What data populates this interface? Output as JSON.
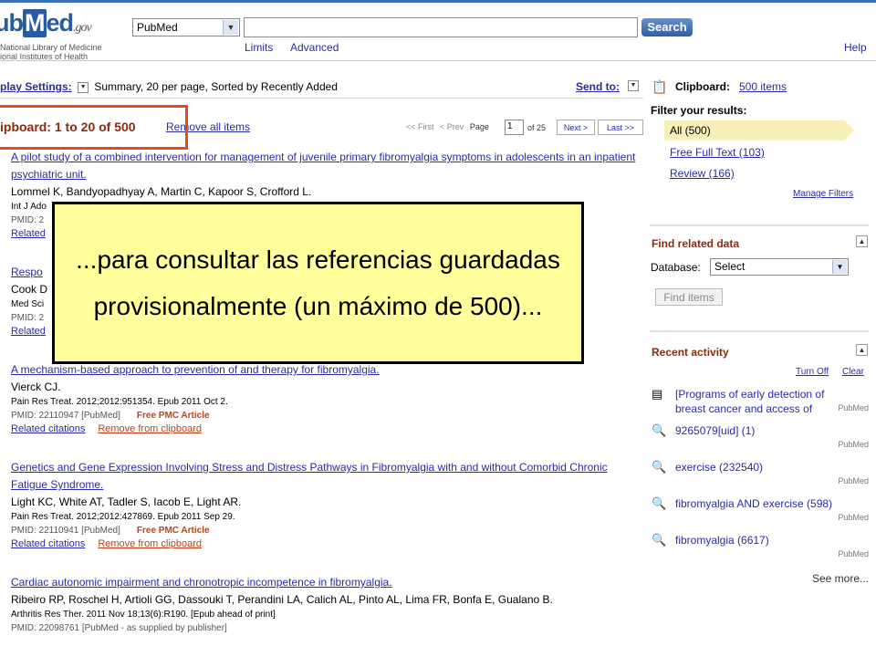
{
  "header": {
    "logo_text": "PubMed",
    "logo_gov": ".gov",
    "nlm_line1": "National Library of Medicine",
    "nlm_line2": "ional Institutes of Health",
    "db_value": "PubMed",
    "search_label": "Search",
    "limits": "Limits",
    "advanced": "Advanced",
    "help": "Help"
  },
  "toolbar": {
    "display_settings_label": "play Settings:",
    "display_settings_value": "Summary, 20 per page, Sorted by Recently Added",
    "send_to": "Send to:"
  },
  "clipboard": {
    "count": "ipboard: 1 to 20 of 500",
    "remove_all": "Remove all items"
  },
  "pager": {
    "first": "<< First",
    "prev": "< Prev",
    "page_label": "Page",
    "page_value": "1",
    "of": "of 25",
    "next": "Next >",
    "last": "Last >>"
  },
  "results": [
    {
      "title": "A pilot study of a combined intervention for management of juvenile primary fibromyalgia symptoms in adolescents in an inpatient psychiatric unit.",
      "authors": "Lommel K, Bandyopadhyay A, Martin C, Kapoor S, Crofford L.",
      "journal": "Int J Ado",
      "pmid": "PMID: 2",
      "related": "Related"
    },
    {
      "title": "Respo",
      "authors": "Cook D",
      "journal": "Med Sci",
      "pmid": "PMID: 2",
      "related": "Related"
    },
    {
      "title": "A mechanism-based approach to prevention of and therapy for fibromyalgia.",
      "authors": "Vierck CJ.",
      "journal": "Pain Res Treat. 2012;2012:951354. Epub 2011 Oct 2.",
      "pmid": "PMID: 22110947 [PubMed]",
      "free": "Free PMC Article",
      "related": "Related citations",
      "remove": "Remove from clipboard"
    },
    {
      "title": "Genetics and Gene Expression Involving Stress and Distress Pathways in Fibromyalgia with and without Comorbid Chronic Fatigue Syndrome.",
      "authors": "Light KC, White AT, Tadler S, Iacob E, Light AR.",
      "journal": "Pain Res Treat. 2012;2012:427869. Epub 2011 Sep 29.",
      "pmid": "PMID: 22110941 [PubMed]",
      "free": "Free PMC Article",
      "related": "Related citations",
      "remove": "Remove from clipboard"
    },
    {
      "title": "Cardiac autonomic impairment and chronotropic incompetence in fibromyalgia.",
      "authors": "Ribeiro RP, Roschel H, Artioli GG, Dassouki T, Perandini LA, Calich AL, Pinto AL, Lima FR, Bonfa E, Gualano B.",
      "journal": "Arthritis Res Ther. 2011 Nov 18;13(6):R190. [Epub ahead of print]",
      "pmid": "PMID: 22098761 [PubMed - as supplied by publisher]"
    }
  ],
  "sidebar": {
    "clipboard_label": "Clipboard:",
    "clipboard_items": "500 items",
    "filter_title": "Filter your results:",
    "filters": [
      "All (500)",
      "Free Full Text (103)",
      "Review (166)"
    ],
    "manage_filters": "Manage Filters",
    "find_related_title": "Find related data",
    "database_label": "Database:",
    "database_value": "Select",
    "find_items": "Find items",
    "recent_title": "Recent activity",
    "turn_off": "Turn Off",
    "clear": "Clear",
    "recent": [
      {
        "text": "[Programs of early detection of breast cancer and access of",
        "source": "PubMed",
        "icon": "document-icon"
      },
      {
        "text": "9265079[uid] (1)",
        "source": "PubMed",
        "icon": "search-icon"
      },
      {
        "text": "exercise (232540)",
        "source": "PubMed",
        "icon": "search-icon"
      },
      {
        "text": "fibromyalgia AND exercise (598)",
        "source": "PubMed",
        "icon": "search-icon"
      },
      {
        "text": "fibromyalgia (6617)",
        "source": "PubMed",
        "icon": "search-icon"
      }
    ],
    "see_more": "See more..."
  },
  "overlay": {
    "text": "...para consultar las referencias guardadas provisionalmente (un máximo de 500)..."
  },
  "colors": {
    "link": "#2a2aa8",
    "heading": "#8b2b0b",
    "highlight_border": "#e74a1e",
    "overlay_bg": "#ffff9c",
    "filter_active": "#f7f0b8"
  }
}
